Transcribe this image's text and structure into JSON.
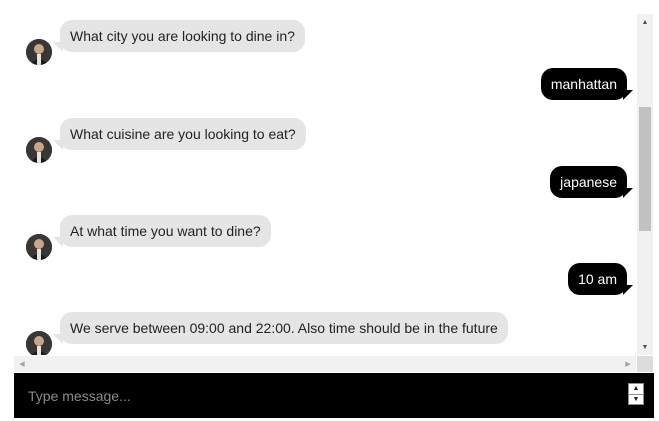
{
  "messages": [
    {
      "from": "bot",
      "text": "What city you are looking to dine in?"
    },
    {
      "from": "user",
      "text": "manhattan"
    },
    {
      "from": "bot",
      "text": "What cuisine are you looking to eat?"
    },
    {
      "from": "user",
      "text": "japanese"
    },
    {
      "from": "bot",
      "text": "At what time you want to dine?"
    },
    {
      "from": "user",
      "text": "10 am"
    },
    {
      "from": "bot",
      "text": "We serve between 09:00 and 22:00. Also time should be in the future"
    }
  ],
  "composer": {
    "placeholder": "Type message..."
  },
  "icons": {
    "avatar": "bot-avatar-icon",
    "scroll_up": "scroll-up-arrow-icon",
    "scroll_down": "scroll-down-arrow-icon",
    "scroll_left": "scroll-left-arrow-icon",
    "scroll_right": "scroll-right-arrow-icon",
    "spinner": "number-spinner-icon"
  },
  "colors": {
    "bot_bubble": "#e5e5e5",
    "user_bubble": "#000000",
    "composer_bg": "#000000"
  }
}
